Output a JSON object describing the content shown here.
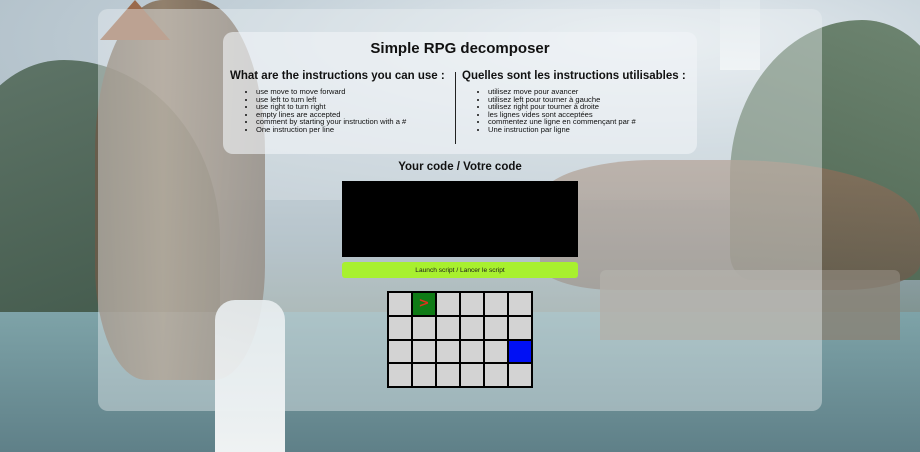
{
  "app": {
    "title": "Simple RPG decomposer"
  },
  "instructions": {
    "english": {
      "heading": "What are the instructions you can use :",
      "items": [
        "use move to move forward",
        "use left to turn left",
        "use right to turn right",
        "empty lines are accepted",
        "comment by starting your instruction with a #",
        "One instruction per line"
      ]
    },
    "french": {
      "heading": "Quelles sont les instructions utilisables :",
      "items": [
        "utilisez move pour avancer",
        "utilisez left pour tourner à gauche",
        "utilisez right pour tourner à droite",
        "les lignes vides sont acceptées",
        "commentez une ligne en commençant par #",
        "Une instruction par ligne"
      ]
    }
  },
  "editor": {
    "label": "Your code / Votre code",
    "value": ""
  },
  "launch_button": {
    "label": "Launch script / Lancer le script"
  },
  "board": {
    "rows": 4,
    "columns": 6,
    "player": {
      "row": 0,
      "col": 1,
      "glyph": ">",
      "facing": "right"
    },
    "goal": {
      "row": 2,
      "col": 5
    },
    "colors": {
      "empty": "#d3d3d3",
      "player_tile": "#0f7b16",
      "player_glyph": "#e0301e",
      "goal": "#0010f5",
      "grid_lines": "#000000",
      "launch_button": "#a8f02f",
      "editor_bg": "#000000"
    }
  }
}
